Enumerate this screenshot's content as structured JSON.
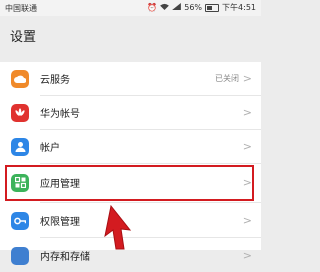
{
  "status_bar": {
    "carrier": "中国联通",
    "battery": "56%",
    "time": "下午4:51"
  },
  "header": {
    "title": "设置"
  },
  "settings": {
    "items": [
      {
        "label": "云服务",
        "value": "已关闭",
        "icon": "cloud-icon",
        "color": "#f08a2a"
      },
      {
        "label": "华为帐号",
        "icon": "huawei-logo-icon",
        "color": "#e0322f"
      },
      {
        "label": "帐户",
        "icon": "account-icon",
        "color": "#2d86e6"
      },
      {
        "label": "应用管理",
        "icon": "apps-grid-icon",
        "color": "#3cb35b"
      },
      {
        "label": "权限管理",
        "icon": "key-icon",
        "color": "#2d86e6"
      },
      {
        "label": "内存和存储",
        "icon": "storage-icon",
        "color": "#3f7fd0"
      }
    ]
  },
  "annotation": {
    "highlight_color": "#d31b20"
  }
}
